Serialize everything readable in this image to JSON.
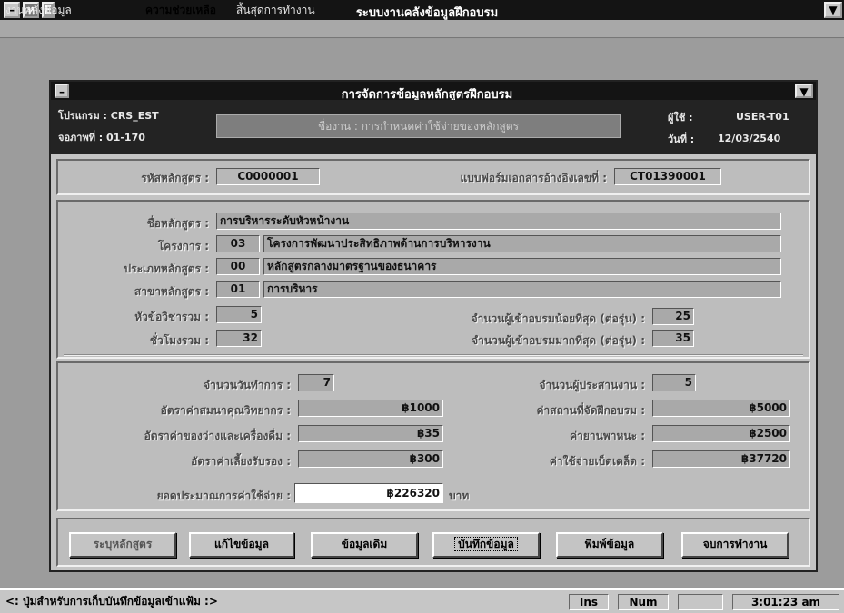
{
  "outer_window": {
    "title": "ระบบงานคลังข้อมูลฝึกอบรม",
    "sys_icon": "minus-icon",
    "app_icon_label": "ห",
    "app_icon2_label": "E",
    "arrow_icon": "down-triangle-icon"
  },
  "menu": {
    "items": [
      "งานคลังข้อมูล",
      "ความช่วยเหลือ",
      "สิ้นสุดการทำงาน"
    ]
  },
  "inner_window": {
    "title": "การจัดการข้อมูลหลักสูตรฝึกอบรม",
    "program_label": "โปรแกรม : CRS_EST",
    "screen_label": "จอภาพที่ : 01-170",
    "job_label": "ชื่องาน : การกำหนดค่าใช้จ่ายของหลักสูตร",
    "user_label": "ผู้ใช้ :",
    "user_value": "USER-T01",
    "date_label": "วันที่ :",
    "date_value": "12/03/2540"
  },
  "form": {
    "course_code_label": "รหัสหลักสูตร :",
    "course_code": "C0000001",
    "form_ref_label": "แบบฟอร์มเอกสารอ้างอิงเลขที่ :",
    "form_ref": "CT01390001",
    "course_name_label": "ชื่อหลักสูตร :",
    "course_name": "การบริหารระดับหัวหน้างาน",
    "project_label": "โครงการ :",
    "project_code": "03",
    "project_name": "โครงการพัฒนาประสิทธิภาพด้านการบริหารงาน",
    "type_label": "ประเภทหลักสูตร :",
    "type_code": "00",
    "type_name": "หลักสูตรกลางมาตรฐานของธนาคาร",
    "branch_label": "สาขาหลักสูตร :",
    "branch_code": "01",
    "branch_name": "การบริหาร",
    "total_topics_label": "หัวข้อวิชารวม :",
    "total_topics": "5",
    "total_hours_label": "ชั่วโมงรวม :",
    "total_hours": "32",
    "min_trainees_label": "จำนวนผู้เข้าอบรมน้อยที่สุด (ต่อรุ่น) :",
    "min_trainees": "25",
    "max_trainees_label": "จำนวนผู้เข้าอบรมมากที่สุด (ต่อรุ่น) :",
    "max_trainees": "35",
    "workdays_label": "จำนวนวันทำการ :",
    "workdays": "7",
    "coordinators_label": "จำนวนผู้ประสานงาน :",
    "coordinators": "5",
    "lecturer_rate_label": "อัตราค่าสมนาคุณวิทยากร :",
    "lecturer_rate": "฿1000",
    "venue_label": "ค่าสถานที่จัดฝึกอบรม :",
    "venue": "฿5000",
    "snack_label": "อัตราค่าของว่างและเครื่องดื่ม :",
    "snack": "฿35",
    "vehicle_label": "ค่ายานพาหนะ :",
    "vehicle": "฿2500",
    "meal_label": "อัตราค่าเลี้ยงรับรอง :",
    "meal": "฿300",
    "misc_label": "ค่าใช้จ่ายเบ็ดเตล็ด :",
    "misc": "฿37720",
    "budget_label": "ยอดประมาณการค่าใช้จ่าย :",
    "budget": "฿226320",
    "budget_unit": "บาท"
  },
  "buttons": {
    "specify_course": "ระบุหลักสูตร",
    "edit": "แก้ไขข้อมูล",
    "original": "ข้อมูลเดิม",
    "save": "บันทึกข้อมูล",
    "print": "พิมพ์ข้อมูล",
    "exit": "จบการทำงาน"
  },
  "status": {
    "message": "<: ปุ่มสำหรับการเก็บบันทึกข้อมูลเข้าแฟ้ม :>",
    "ins": "Ins",
    "num": "Num",
    "time": "3:01:23 am"
  }
}
